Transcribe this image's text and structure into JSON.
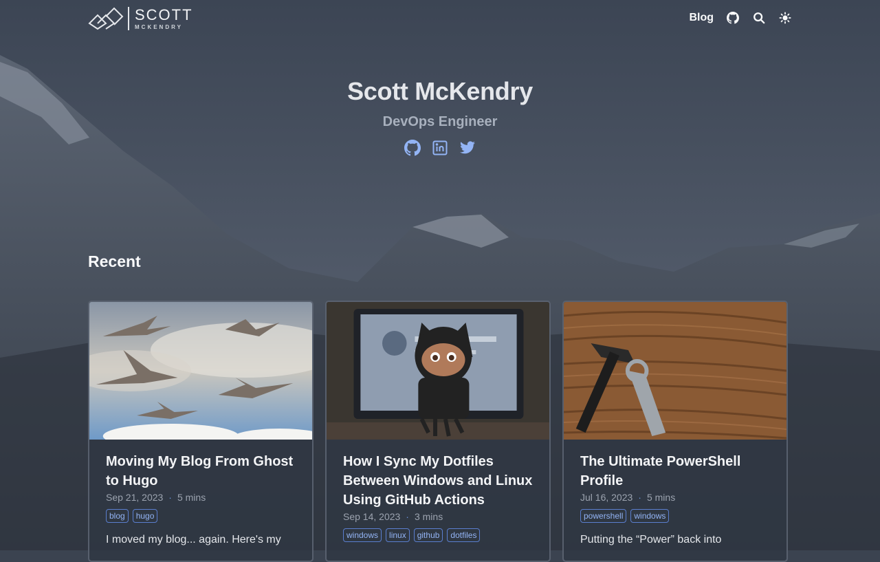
{
  "header": {
    "logo_top": "SCOTT",
    "logo_bottom": "MCKENDRY",
    "nav_blog": "Blog",
    "icons": [
      "github-icon",
      "search-icon",
      "theme-toggle-icon"
    ]
  },
  "hero": {
    "name": "Scott McKendry",
    "role": "DevOps Engineer",
    "social": [
      "github-icon",
      "linkedin-icon",
      "twitter-icon"
    ]
  },
  "recent": {
    "title": "Recent",
    "posts": [
      {
        "title": "Moving My Blog From Ghost to Hugo",
        "date": "Sep 21, 2023",
        "read": "5 mins",
        "tags": [
          "blog",
          "hugo"
        ],
        "excerpt": "I moved my blog... again. Here's my"
      },
      {
        "title": "How I Sync My Dotfiles Between Windows and Linux Using GitHub Actions",
        "date": "Sep 14, 2023",
        "read": "3 mins",
        "tags": [
          "windows",
          "linux",
          "github",
          "dotfiles"
        ],
        "excerpt": ""
      },
      {
        "title": "The Ultimate PowerShell Profile",
        "date": "Jul 16, 2023",
        "read": "5 mins",
        "tags": [
          "powershell",
          "windows"
        ],
        "excerpt": "Putting the “Power” back into"
      }
    ]
  },
  "colors": {
    "accent": "#93b4f5",
    "tag_border": "#5b7fd0",
    "card_bg": "#303743"
  }
}
